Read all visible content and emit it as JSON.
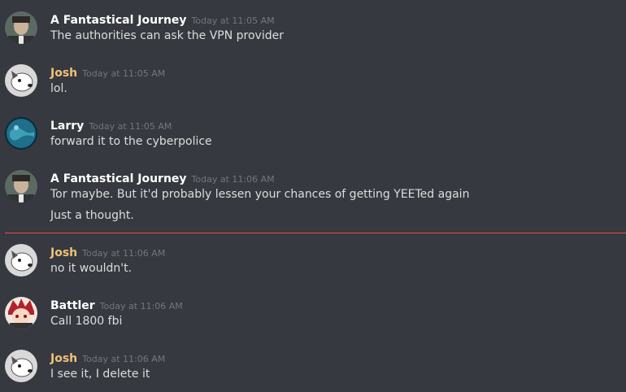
{
  "messages": [
    {
      "author": "A Fantastical Journey",
      "timestamp": "Today at 11:05 AM",
      "lines": [
        "The authorities can ask the VPN provider"
      ],
      "avatar": "fantastical-avatar"
    },
    {
      "author": "Josh",
      "timestamp": "Today at 11:05 AM",
      "lines": [
        "lol."
      ],
      "avatar": "dog-avatar"
    },
    {
      "author": "Larry",
      "timestamp": "Today at 11:05 AM",
      "lines": [
        "forward it to the cyberpolice"
      ],
      "avatar": "planet-avatar"
    },
    {
      "author": "A Fantastical Journey",
      "timestamp": "Today at 11:06 AM",
      "lines": [
        "Tor maybe. But it'd probably lessen your chances of getting YEETed again",
        "Just a thought."
      ],
      "avatar": "fantastical-avatar"
    },
    {
      "author": "Josh",
      "timestamp": "Today at 11:06 AM",
      "lines": [
        "no it wouldn't."
      ],
      "avatar": "dog-avatar"
    },
    {
      "author": "Battler",
      "timestamp": "Today at 11:06 AM",
      "lines": [
        "Call 1800 fbi"
      ],
      "avatar": "anime-avatar"
    },
    {
      "author": "Josh",
      "timestamp": "Today at 11:06 AM",
      "lines": [
        "I see it, I delete it"
      ],
      "avatar": "dog-avatar"
    }
  ],
  "colors": {
    "background": "#36393f",
    "josh_name": "#f0c27b",
    "new_messages_divider": "#f04747"
  }
}
